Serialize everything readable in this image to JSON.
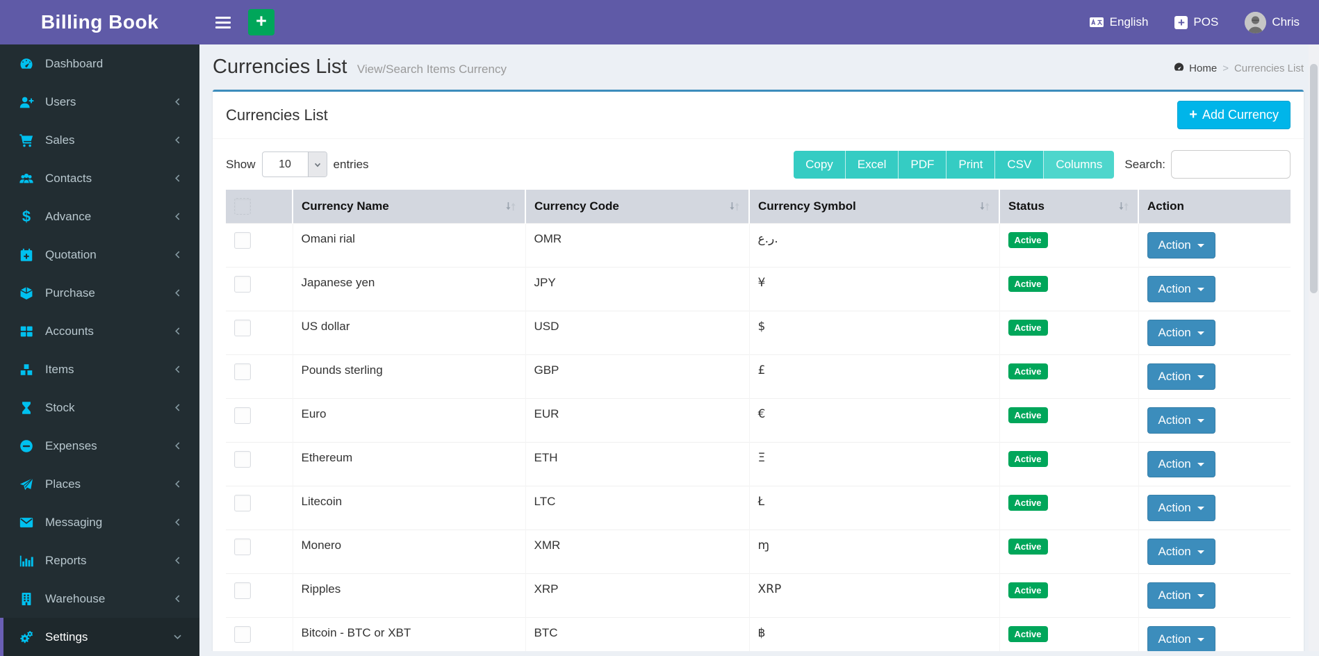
{
  "app": {
    "title": "Billing Book"
  },
  "icons": {
    "plus": "+",
    "dollar": "$"
  },
  "topbar": {
    "language": "English",
    "pos_label": "POS",
    "username": "Chris"
  },
  "sidebar": {
    "items": [
      {
        "label": "Dashboard",
        "icon": "tachometer-icon",
        "expandable": false,
        "active": false
      },
      {
        "label": "Users",
        "icon": "user-plus-icon",
        "expandable": true,
        "active": false
      },
      {
        "label": "Sales",
        "icon": "shopping-cart-icon",
        "expandable": true,
        "active": false
      },
      {
        "label": "Contacts",
        "icon": "users-icon",
        "expandable": true,
        "active": false
      },
      {
        "label": "Advance",
        "icon": "dollar-icon",
        "expandable": true,
        "active": false
      },
      {
        "label": "Quotation",
        "icon": "calendar-plus-icon",
        "expandable": true,
        "active": false
      },
      {
        "label": "Purchase",
        "icon": "cube-icon",
        "expandable": true,
        "active": false
      },
      {
        "label": "Accounts",
        "icon": "grid-icon",
        "expandable": true,
        "active": false
      },
      {
        "label": "Items",
        "icon": "cubes-icon",
        "expandable": true,
        "active": false
      },
      {
        "label": "Stock",
        "icon": "hourglass-icon",
        "expandable": true,
        "active": false
      },
      {
        "label": "Expenses",
        "icon": "minus-circle-icon",
        "expandable": true,
        "active": false
      },
      {
        "label": "Places",
        "icon": "paper-plane-icon",
        "expandable": true,
        "active": false
      },
      {
        "label": "Messaging",
        "icon": "envelope-icon",
        "expandable": true,
        "active": false
      },
      {
        "label": "Reports",
        "icon": "bar-chart-icon",
        "expandable": true,
        "active": false
      },
      {
        "label": "Warehouse",
        "icon": "building-icon",
        "expandable": true,
        "active": false
      },
      {
        "label": "Settings",
        "icon": "gears-icon",
        "expandable": true,
        "active": true,
        "expanded": true
      }
    ]
  },
  "page": {
    "title": "Currencies List",
    "subtitle": "View/Search Items Currency",
    "breadcrumb": {
      "home": "Home",
      "separator": ">",
      "current": "Currencies List"
    }
  },
  "panel": {
    "title": "Currencies List",
    "add_button_label": "Add Currency"
  },
  "controls": {
    "show_label": "Show",
    "page_size": "10",
    "entries_label": "entries",
    "export_buttons": [
      "Copy",
      "Excel",
      "PDF",
      "Print",
      "CSV",
      "Columns"
    ],
    "search_label": "Search:",
    "search_value": ""
  },
  "table": {
    "headers": {
      "name": "Currency Name",
      "code": "Currency Code",
      "symbol": "Currency Symbol",
      "status": "Status",
      "action": "Action"
    },
    "action_label": "Action",
    "rows": [
      {
        "name": "Omani rial",
        "code": "OMR",
        "symbol": "ر.ع.",
        "status": "Active"
      },
      {
        "name": "Japanese yen",
        "code": "JPY",
        "symbol": "¥",
        "status": "Active"
      },
      {
        "name": "US dollar",
        "code": "USD",
        "symbol": "$",
        "status": "Active"
      },
      {
        "name": "Pounds sterling",
        "code": "GBP",
        "symbol": "£",
        "status": "Active"
      },
      {
        "name": "Euro",
        "code": "EUR",
        "symbol": "€",
        "status": "Active"
      },
      {
        "name": "Ethereum",
        "code": "ETH",
        "symbol": "Ξ",
        "status": "Active"
      },
      {
        "name": "Litecoin",
        "code": "LTC",
        "symbol": "Ł",
        "status": "Active"
      },
      {
        "name": "Monero",
        "code": "XMR",
        "symbol": "ɱ",
        "status": "Active"
      },
      {
        "name": "Ripples",
        "code": "XRP",
        "symbol": "XRP",
        "status": "Active"
      },
      {
        "name": "Bitcoin - BTC or XBT",
        "code": "BTC",
        "symbol": "฿",
        "status": "Active"
      }
    ]
  },
  "colors": {
    "topbar": "#5f5aa7",
    "sidebar": "#222d32",
    "sidebar_icon": "#00c0ef",
    "panel_accent": "#3c8dbc",
    "add_button": "#00b5e9",
    "export_button": "#35ccc3",
    "status_active": "#00a65a",
    "action_button": "#3c8dbc",
    "table_header_bg": "#d3d7df",
    "quick_add": "#00a65a"
  }
}
